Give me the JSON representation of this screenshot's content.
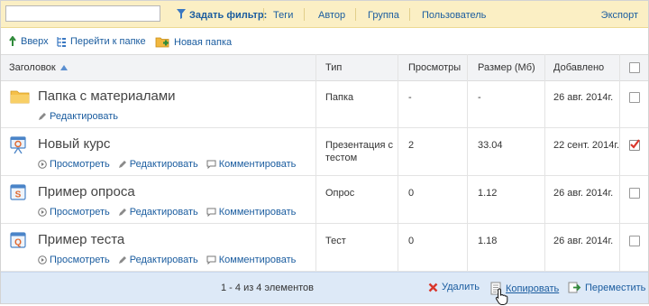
{
  "filterbar": {
    "search_value": "",
    "filter_label": "Задать фильтр:",
    "tabs": [
      "Теги",
      "Автор",
      "Группа",
      "Пользователь"
    ],
    "export_label": "Экспорт"
  },
  "toolbar": {
    "up_label": "Вверх",
    "goto_folder_label": "Перейти к папке",
    "new_folder_label": "Новая папка"
  },
  "table": {
    "headers": {
      "title": "Заголовок",
      "type": "Тип",
      "views": "Просмотры",
      "size": "Размер (Мб)",
      "added": "Добавлено"
    },
    "rows": [
      {
        "icon": "folder-icon",
        "title": "Папка с материалами",
        "actions": [
          "Редактировать"
        ],
        "type": "Папка",
        "views": "-",
        "size": "-",
        "added": "26 авг. 2014г.",
        "checked": false
      },
      {
        "icon": "presentation-icon",
        "title": "Новый курс",
        "actions": [
          "Просмотреть",
          "Редактировать",
          "Комментировать"
        ],
        "type": "Презентация с тестом",
        "views": "2",
        "size": "33.04",
        "added": "22 сент. 2014г.",
        "checked": true
      },
      {
        "icon": "survey-icon",
        "title": "Пример опроса",
        "actions": [
          "Просмотреть",
          "Редактировать",
          "Комментировать"
        ],
        "type": "Опрос",
        "views": "0",
        "size": "1.12",
        "added": "26 авг. 2014г.",
        "checked": false
      },
      {
        "icon": "quiz-icon",
        "title": "Пример теста",
        "actions": [
          "Просмотреть",
          "Редактировать",
          "Комментировать"
        ],
        "type": "Тест",
        "views": "0",
        "size": "1.18",
        "added": "26 авг. 2014г.",
        "checked": false
      }
    ]
  },
  "footer": {
    "pager": "1 - 4 из 4 элементов",
    "delete_label": "Удалить",
    "copy_label": "Копировать",
    "move_label": "Переместить"
  },
  "colors": {
    "link": "#1a5c9f",
    "filterbar_bg": "#fbefc4",
    "footer_bg": "#dde9f7",
    "checkbox_check": "#d9362b"
  }
}
